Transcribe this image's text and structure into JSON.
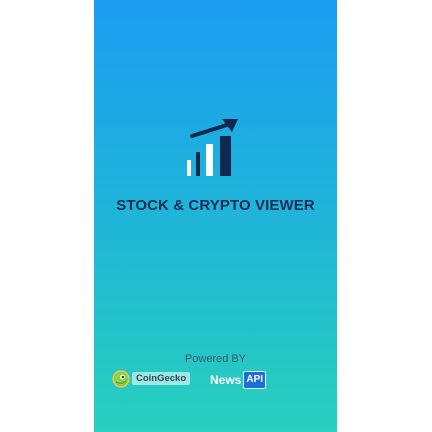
{
  "app": {
    "title": "STOCK & CRYPTO VIEWER",
    "logo_icon": "bar-chart-trend-icon"
  },
  "footer": {
    "powered_by": "Powered BY",
    "providers": [
      {
        "name": "CoinGecko",
        "icon": "coingecko-icon"
      },
      {
        "name": "News",
        "badge": "API"
      }
    ]
  },
  "colors": {
    "gradient_top": "#1a9df2",
    "gradient_bottom": "#28d0bd",
    "title_text": "#1c2e56",
    "logo_dark": "#11294f",
    "logo_white": "#ffffff",
    "api_badge": "#1b6fd6"
  }
}
